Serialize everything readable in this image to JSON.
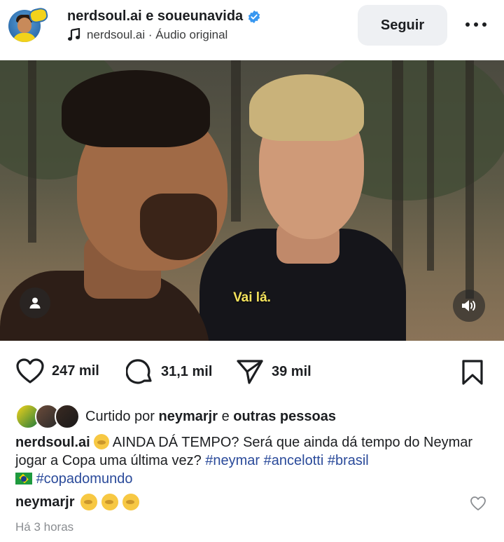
{
  "header": {
    "username": "nerdsoul.ai e soueunavida",
    "audio_source": "nerdsoul.ai",
    "audio_separator": " · ",
    "audio_label": "Áudio original",
    "follow_label": "Seguir",
    "more_icon": "more-horizontal-icon"
  },
  "video": {
    "subtitle": "Vai lá.",
    "user_tag_icon": "person-icon",
    "sound_icon": "speaker-icon"
  },
  "actions": {
    "likes": "247 mil",
    "comments": "31,1 mil",
    "shares": "39 mil"
  },
  "likes_row": {
    "prefix": "Curtido por",
    "user": "neymarjr",
    "connector": "e",
    "others": "outras pessoas"
  },
  "caption": {
    "author": "nerdsoul.ai",
    "text": "AINDA DÁ TEMPO? Será que ainda dá tempo do Neymar jogar a Copa uma última vez?",
    "hashtags": [
      "#neymar",
      "#ancelotti",
      "#brasil"
    ],
    "last_hashtag": "#copadomundo"
  },
  "comment": {
    "author": "neymarjr"
  },
  "timestamp": "Há 3 horas",
  "colors": {
    "verified": "#3897f0",
    "hashtag": "#2a4a9a",
    "subtitle": "#f5e35c",
    "follow_bg": "#eef0f3"
  }
}
